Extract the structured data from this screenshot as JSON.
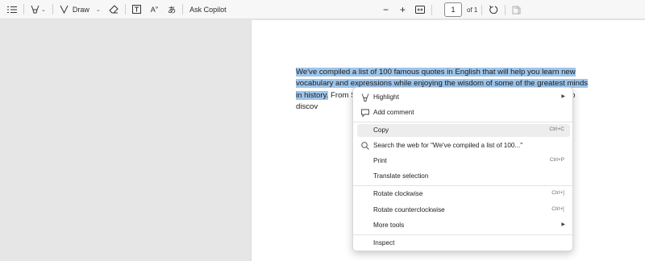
{
  "toolbar": {
    "draw_label": "Draw",
    "ask_copilot_label": "Ask Copilot",
    "page_number": "1",
    "page_of": "of 1"
  },
  "document": {
    "highlighted_text": "We've compiled a list of 100 famous quotes in English that will help you learn new vocabulary and expressions while enjoying the wisdom of some of the greatest minds in history.",
    "line3_rest": "From Sha",
    "line3_end": "eep",
    "line4": "reading to discov"
  },
  "context_menu": {
    "items": [
      {
        "label": "Highlight",
        "icon": "highlighter-icon",
        "submenu": true
      },
      {
        "label": "Add comment",
        "icon": "comment-icon"
      },
      {
        "label": "Copy",
        "shortcut": "Ctrl+C"
      },
      {
        "label": "Search the web for \"We've compiled a list of 100...\"",
        "icon": "search-icon"
      },
      {
        "label": "Print",
        "shortcut": "Ctrl+P"
      },
      {
        "label": "Translate selection"
      },
      {
        "label": "Rotate clockwise",
        "shortcut": "Ctrl+]"
      },
      {
        "label": "Rotate counterclockwise",
        "shortcut": "Ctrl+["
      },
      {
        "label": "More tools",
        "submenu": true
      },
      {
        "label": "Inspect"
      }
    ]
  },
  "colors": {
    "selection_highlight": "#9ec5ea",
    "page_background": "#ffffff",
    "viewer_background": "#e6e6e6"
  }
}
